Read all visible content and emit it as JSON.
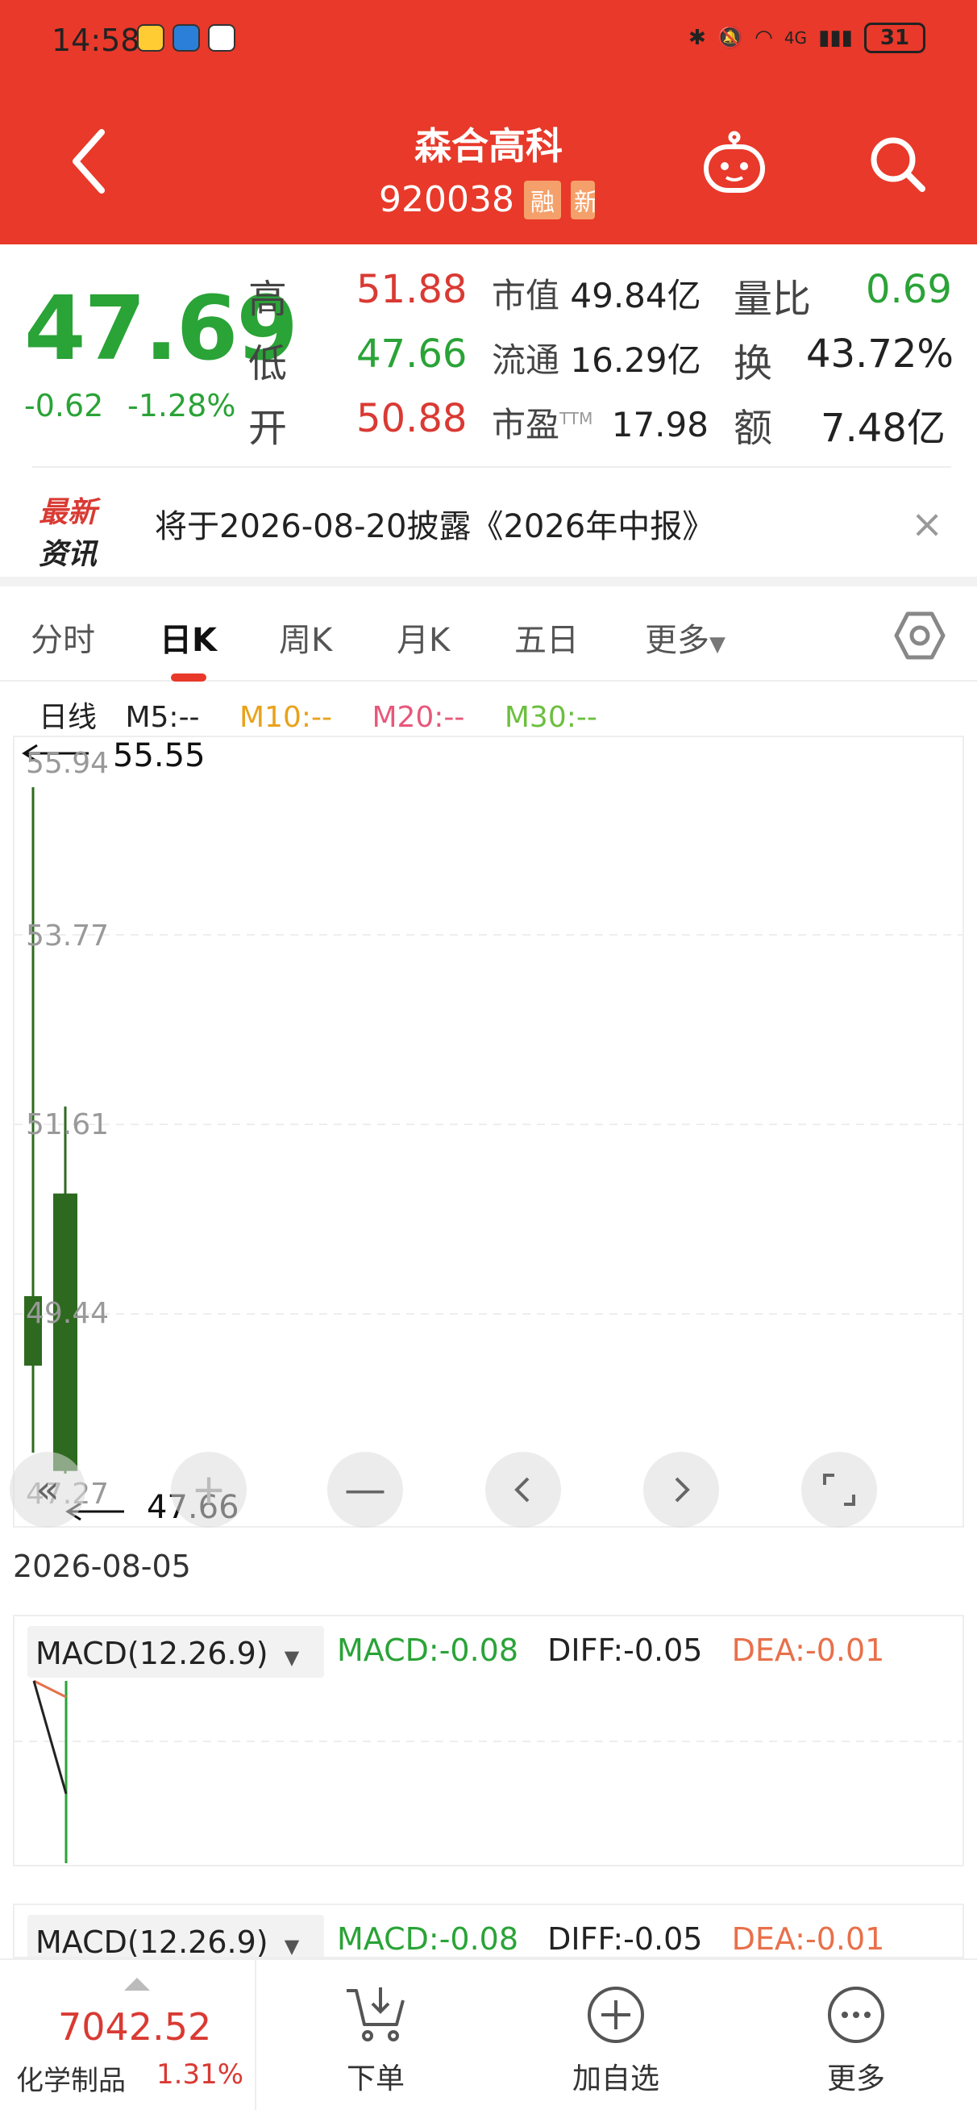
{
  "status_bar": {
    "time": "14:58",
    "signal": "4G",
    "battery": "31"
  },
  "header": {
    "stock_name": "森合高科",
    "stock_code": "920038",
    "tag_margin": "融",
    "tag_new": "新"
  },
  "quote": {
    "price": "47.69",
    "change": "-0.62",
    "change_pct": "-1.28%",
    "high_label": "高",
    "high_value": "51.88",
    "low_label": "低",
    "low_value": "47.66",
    "open_label": "开",
    "open_value": "50.88",
    "mktcap_label": "市值",
    "mktcap_value": "49.84亿",
    "float_label": "流通",
    "float_value": "16.29亿",
    "pe_label": "市盈",
    "pe_sup": "TTM",
    "pe_value": "17.98",
    "vol_ratio_label": "量比",
    "vol_ratio_value": "0.69",
    "turnover_label": "换",
    "turnover_value": "43.72%",
    "amount_label": "额",
    "amount_value": "7.48亿"
  },
  "news": {
    "logo_top": "最新",
    "logo_bottom": "资讯",
    "text": "将于2026-08-20披露《2026年中报》"
  },
  "tabs": [
    "分时",
    "日K",
    "周K",
    "月K",
    "五日",
    "更多"
  ],
  "active_tab": "日K",
  "kline": {
    "legend_title": "日线",
    "ma5": "M5:--",
    "ma10": "M10:--",
    "ma20": "M20:--",
    "ma30": "M30:--",
    "ma_colors": {
      "ma5": "#222222",
      "ma10": "#e8a21b",
      "ma20": "#e8577a",
      "ma30": "#6cbf3e"
    },
    "y_labels": [
      "55.94",
      "53.77",
      "51.61",
      "49.44",
      "47.27"
    ],
    "high_marker": "55.55",
    "low_marker": "47.66",
    "date": "2026-08-05"
  },
  "chart_data": {
    "type": "candlestick",
    "ylim": [
      47.27,
      55.94
    ],
    "candles": [
      {
        "open": 48.9,
        "close": 49.7,
        "high": 55.55,
        "low": 47.9,
        "color": "#2d6a1f"
      },
      {
        "open": 50.88,
        "close": 47.69,
        "high": 51.88,
        "low": 47.66,
        "color": "#2d6a1f"
      }
    ]
  },
  "macd": {
    "selector": "MACD(12.26.9)",
    "macd_value": "MACD:-0.08",
    "diff_value": "DIFF:-0.05",
    "dea_value": "DEA:-0.01"
  },
  "bottom_bar": {
    "index_value": "7042.52",
    "index_name": "化学制品",
    "index_pct": "1.31%",
    "order_label": "下单",
    "watchlist_label": "加自选",
    "more_label": "更多"
  },
  "colors": {
    "brand_red": "#e8392a",
    "up_red": "#d93a33",
    "down_green": "#2aa337",
    "candle_green": "#2d6a1f"
  }
}
